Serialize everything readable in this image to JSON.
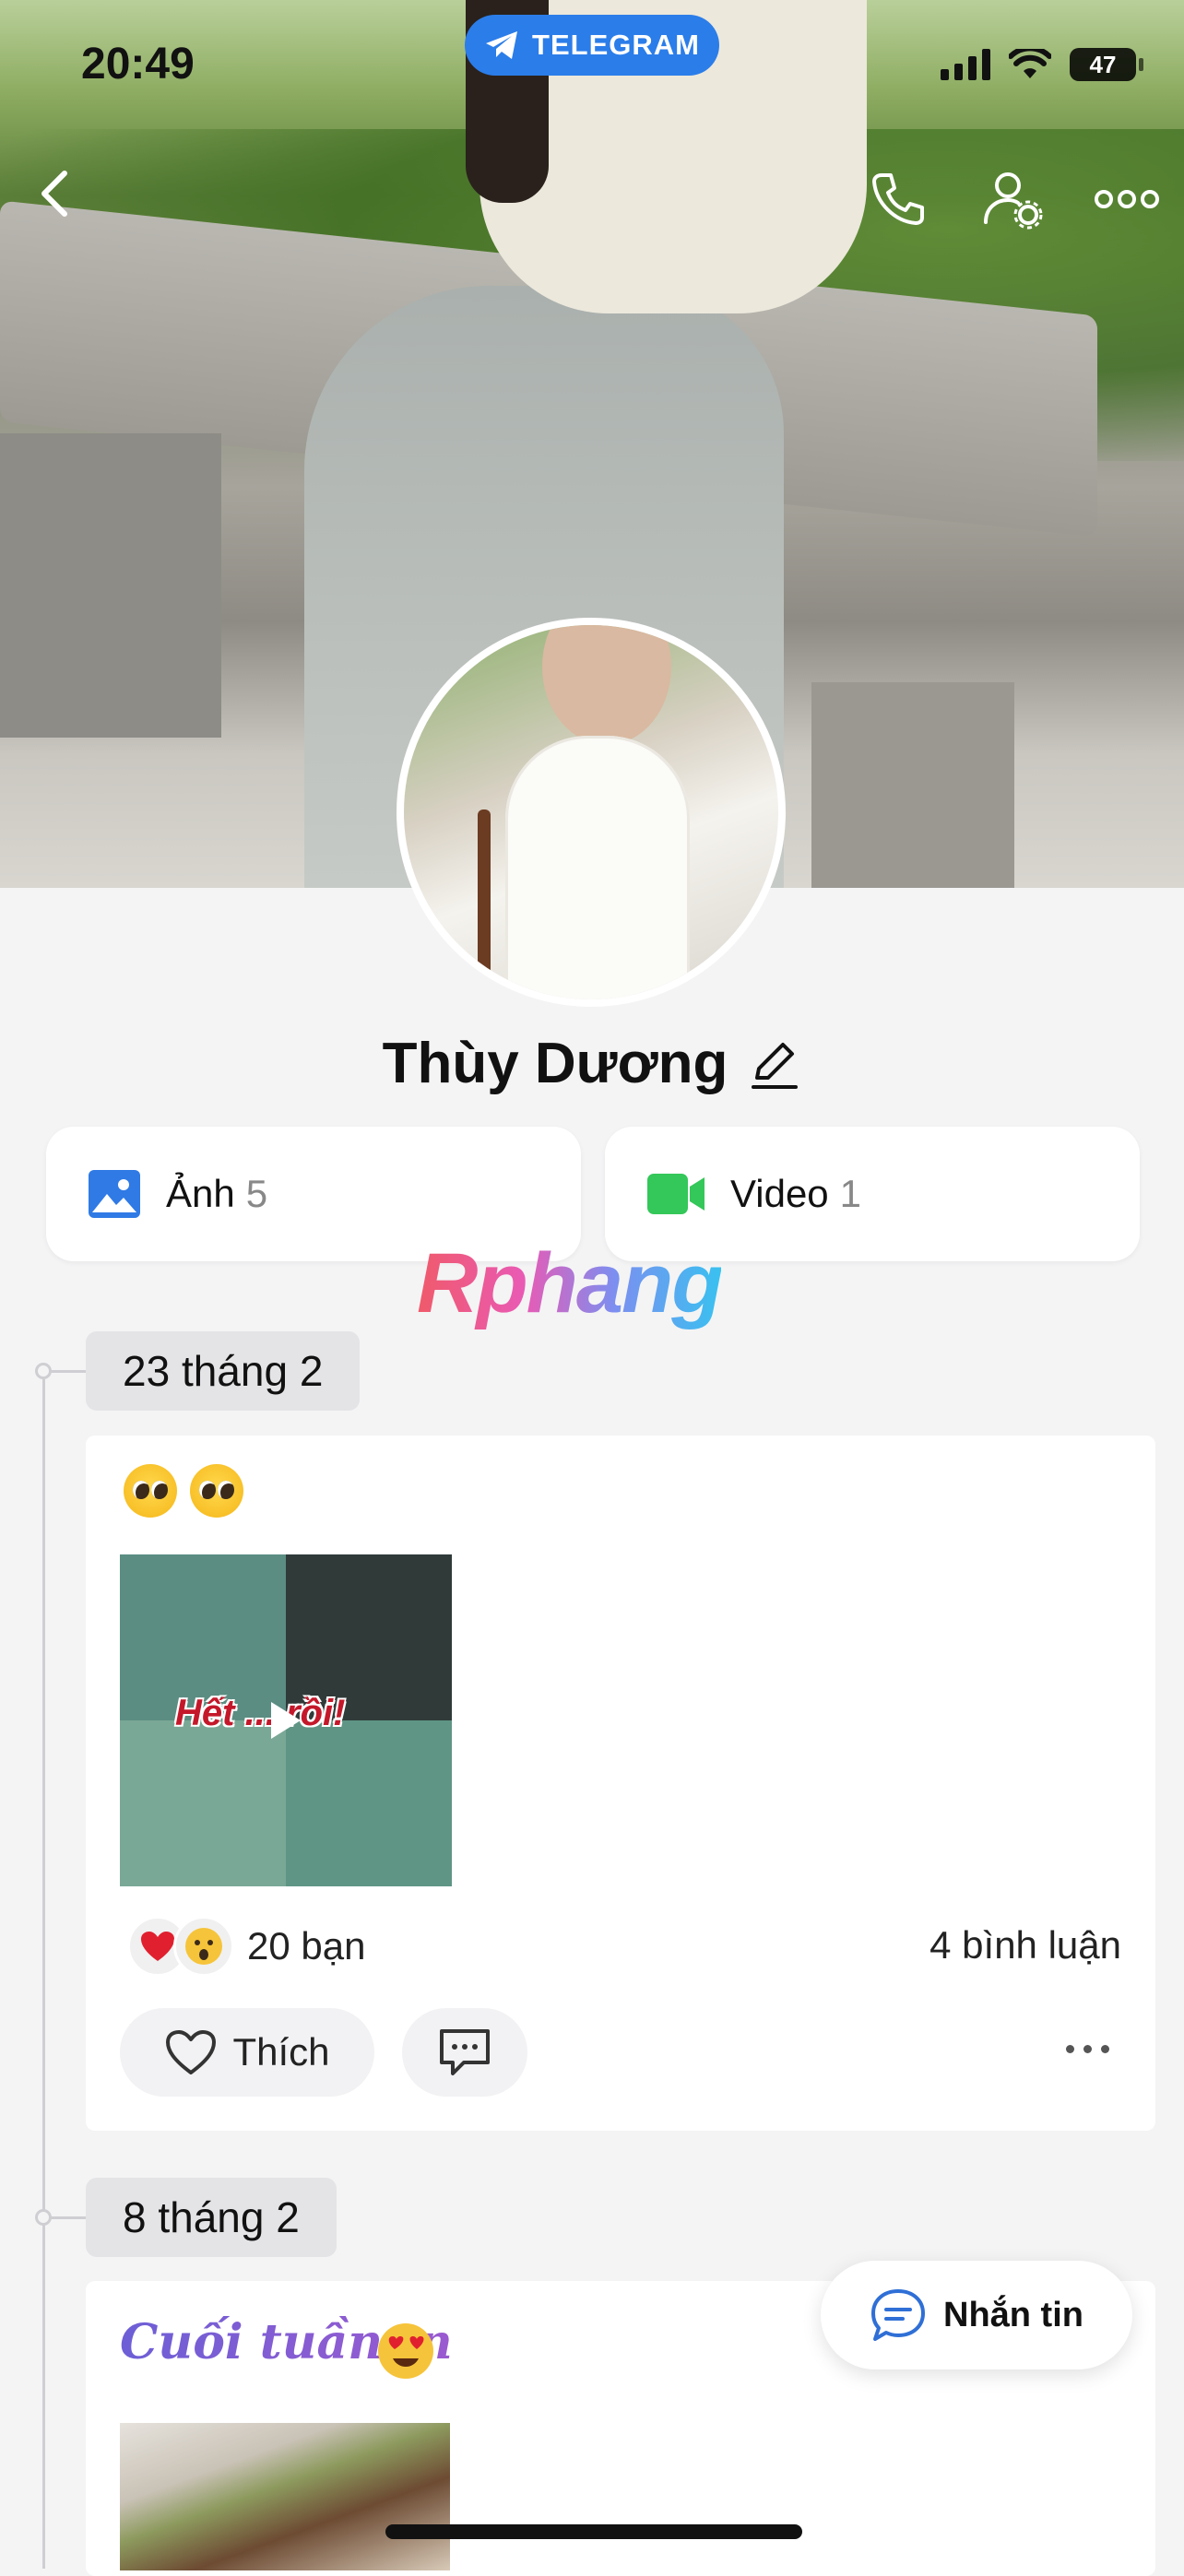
{
  "status_bar": {
    "time": "20:49",
    "battery": "47"
  },
  "banner": {
    "label": "TELEGRAM"
  },
  "profile": {
    "name": "Thùy Dương"
  },
  "media": {
    "photos": {
      "label": "Ảnh",
      "count": "5"
    },
    "videos": {
      "label": "Video",
      "count": "1"
    }
  },
  "watermark": "Rphang",
  "timeline": [
    {
      "date": "23 tháng 2",
      "video_caption": "Hết ... rồi!",
      "reactions_text": "20 bạn",
      "comments_text": "4 bình luận",
      "like_label": "Thích"
    },
    {
      "date": "8 tháng 2",
      "title": "Cuối tuầnnn"
    }
  ],
  "message_button": {
    "label": "Nhắn tin"
  },
  "colors": {
    "accent": "#2b7de9",
    "video_icon": "#34c759",
    "photo_icon": "#2f7ae5",
    "chip": "#e4e4e7"
  }
}
